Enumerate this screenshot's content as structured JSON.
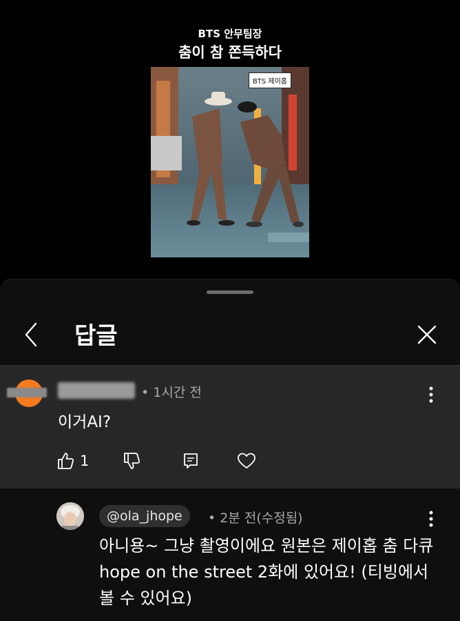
{
  "video": {
    "subtitle": "BTS 안무팀장",
    "title": "춤이 참 쫀득하다",
    "thumbnail_tag": "BTS 제이홉"
  },
  "header": {
    "title": "답글"
  },
  "parent_comment": {
    "meta": "• 1시간 전",
    "text": "이거AI?",
    "like_count": "1"
  },
  "reply": {
    "handle": "@ola_jhope",
    "meta": "• 2분 전(수정됨)",
    "text": "아니용~ 그냥 촬영이에요 원본은 제이홉 춤 다큐 hope on the street 2화에 있어요! (티빙에서 볼 수 있어요)"
  },
  "icons": {
    "back": "chevron-left-icon",
    "close": "close-icon",
    "more": "more-vert-icon",
    "like": "thumb-up-icon",
    "dislike": "thumb-down-icon",
    "reply": "comment-icon",
    "heart": "heart-icon"
  },
  "colors": {
    "background": "#0f0f0f",
    "parent_bg": "#272727",
    "avatar_orange": "#f47b1f",
    "meta_text": "#aaaaaa",
    "handle_bg": "#2f2f2f"
  }
}
